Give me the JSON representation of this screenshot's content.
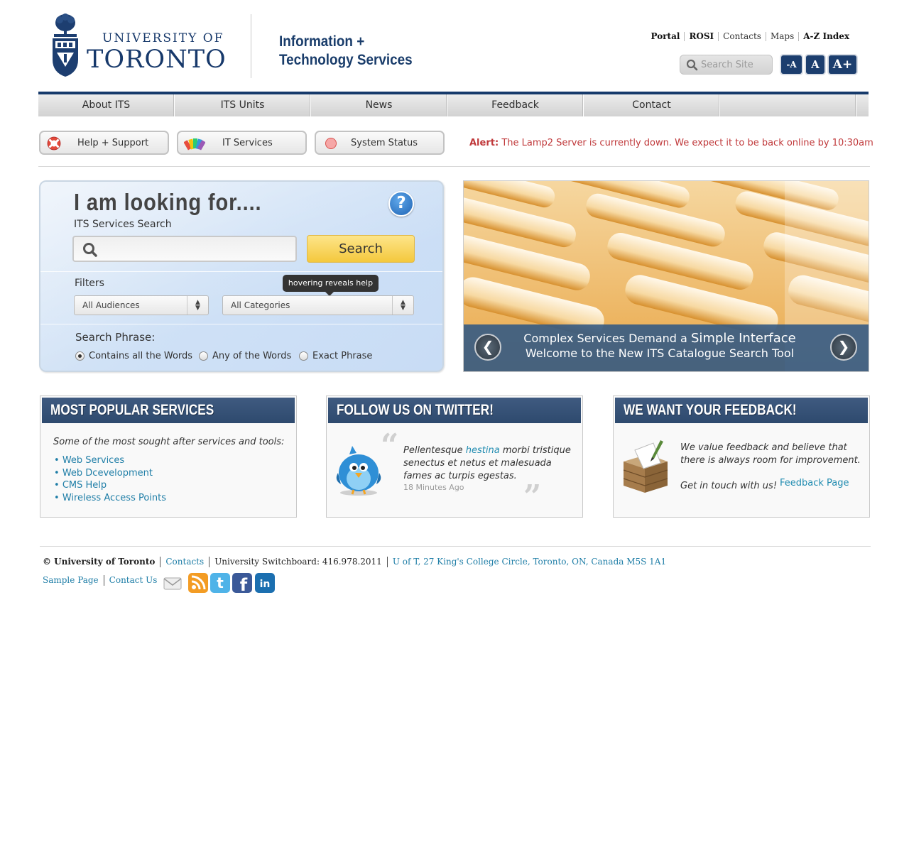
{
  "header": {
    "logo_line1": "UNIVERSITY OF",
    "logo_line2": "TORONTO",
    "site_title_line1": "Information +",
    "site_title_line2": "Technology Services",
    "util_links": [
      "Portal",
      "ROSI",
      "Contacts",
      "Maps",
      "A-Z Index"
    ],
    "search_placeholder": "Search Site",
    "font_sizes": [
      "-A",
      "A",
      "A+"
    ]
  },
  "nav": {
    "items": [
      "About ITS",
      "ITS Units",
      "News",
      "Feedback",
      "Contact",
      ""
    ]
  },
  "quick_links": [
    {
      "label": "Help + Support",
      "icon": "lifebuoy-icon"
    },
    {
      "label": "IT Services",
      "icon": "swatches-icon"
    },
    {
      "label": "System Status",
      "icon": "status-dot-icon"
    }
  ],
  "alert": {
    "label": "Alert:",
    "message": "The Lamp2 Server is currently down. We expect it to be back online by 10:30am"
  },
  "finder": {
    "title": "I am looking for....",
    "subtitle": "ITS Services Search",
    "search_value": "",
    "search_button": "Search",
    "filters_label": "Filters",
    "tooltip": "hovering reveals help",
    "audience_value": "All Audiences",
    "category_value": "All Categories",
    "phrase_label": "Search Phrase:",
    "phrase_options": [
      {
        "label": "Contains all the Words",
        "selected": true
      },
      {
        "label": "Any of the Words",
        "selected": false
      },
      {
        "label": "Exact Phrase",
        "selected": false
      }
    ]
  },
  "hero": {
    "line1_pre": "Complex Services Demand a",
    "line1_strong": "Simple Interface",
    "line2": "Welcome to the New ITS Catalogue Search Tool",
    "prev": "❮",
    "next": "❯"
  },
  "popular": {
    "heading": "MOST POPULAR SERVICES",
    "intro": "Some of the most sought after services and tools:",
    "links": [
      "Web Services",
      "Web Dcevelopment",
      "CMS Help",
      "Wireless Access Points"
    ]
  },
  "twitter": {
    "heading": "FOLLOW US ON TWITTER!",
    "tweet_pre": "Pellentesque",
    "tweet_link": "hestina",
    "tweet_post": "morbi tristique senectus et netus et malesuada fames ac turpis egestas.",
    "time": "18 Minutes Ago"
  },
  "feedback": {
    "heading": "WE WANT YOUR FEEDBACK!",
    "text": "We value feedback and believe that there is always room for improvement.",
    "cta": "Get in touch with us!",
    "link": "Feedback Page"
  },
  "footer": {
    "copyright": "© University of Toronto",
    "contacts": "Contacts",
    "switchboard": "University Switchboard: 416.978.2011",
    "address": "U of T, 27 King's College Circle, Toronto, ON, Canada M5S 1A1",
    "sample_page": "Sample Page",
    "contact_us": "Contact Us",
    "social_icons": [
      "mail-icon",
      "rss-icon",
      "twitter-icon",
      "facebook-icon",
      "linkedin-icon"
    ]
  },
  "colors": {
    "brand_navy": "#163a6b",
    "link_teal": "#1f7ea7",
    "alert_red": "#c0393b",
    "search_yellow": "#f4c83d"
  }
}
